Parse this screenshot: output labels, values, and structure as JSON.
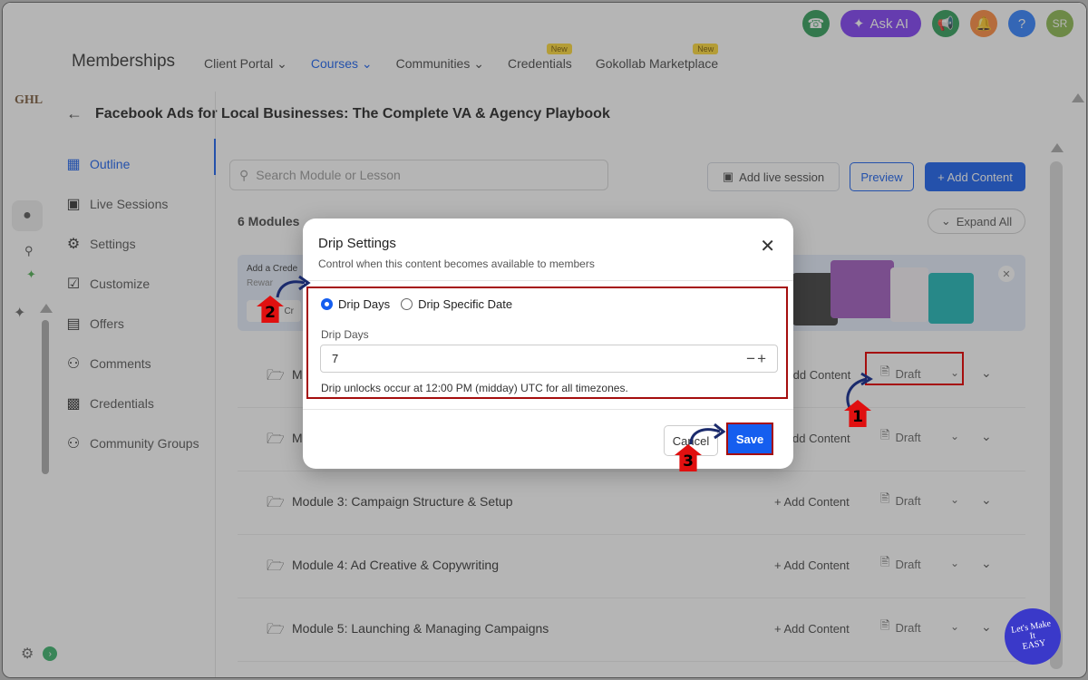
{
  "topbar": {
    "ask_ai": "Ask AI",
    "avatar_initials": "SR",
    "icons": [
      "phone-icon",
      "ask-ai-sparkle-icon",
      "megaphone-icon",
      "bell-icon",
      "help-icon",
      "avatar"
    ],
    "colors": {
      "phone": "#2e9d57",
      "askai": "#7e3cf5",
      "megaphone": "#2e9d57",
      "bell": "#ff8a3c",
      "help": "#2f80ff",
      "avatar": "#8bb94e"
    }
  },
  "header": {
    "brand": "Memberships",
    "nav": [
      {
        "label": "Client Portal",
        "chevron": true,
        "active": false
      },
      {
        "label": "Courses",
        "chevron": true,
        "active": true
      },
      {
        "label": "Communities",
        "chevron": true,
        "active": false
      },
      {
        "label": "Credentials",
        "badge": "New",
        "active": false
      },
      {
        "label": "Gokollab Marketplace",
        "badge": "New",
        "active": false
      }
    ],
    "logo": "GHL",
    "course_title": "Facebook Ads for Local Businesses: The Complete VA & Agency Playbook"
  },
  "sidebar": {
    "items": [
      {
        "label": "Outline",
        "icon": "table-icon",
        "active": true
      },
      {
        "label": "Live Sessions",
        "icon": "video-icon",
        "active": false
      },
      {
        "label": "Settings",
        "icon": "gear-icon",
        "active": false
      },
      {
        "label": "Customize",
        "icon": "clipboard-icon",
        "active": false
      },
      {
        "label": "Offers",
        "icon": "chart-icon",
        "active": false
      },
      {
        "label": "Comments",
        "icon": "users-icon",
        "active": false
      },
      {
        "label": "Credentials",
        "icon": "certificate-icon",
        "active": false
      },
      {
        "label": "Community Groups",
        "icon": "group-icon",
        "active": false
      }
    ]
  },
  "main": {
    "search_placeholder": "Search Module or Lesson",
    "add_live_session": "Add live session",
    "preview": "Preview",
    "add_content": "+ Add Content",
    "module_count": "6 Modules",
    "expand_all": "Expand All",
    "banner_title": "Add a Crede",
    "banner_sub": "Rewar",
    "banner_btn": "Cr",
    "modules": [
      {
        "title": "M",
        "add": "Add Content",
        "status": "Draft"
      },
      {
        "title": "M",
        "add": "dd Content",
        "status": "Draft"
      },
      {
        "title": "Module 3: Campaign Structure & Setup",
        "add": "+ Add Content",
        "status": "Draft"
      },
      {
        "title": "Module 4: Ad Creative & Copywriting",
        "add": "+ Add Content",
        "status": "Draft"
      },
      {
        "title": "Module 5: Launching & Managing Campaigns",
        "add": "+ Add Content",
        "status": "Draft"
      }
    ]
  },
  "modal": {
    "title": "Drip Settings",
    "subtitle": "Control when this content becomes available to members",
    "option_days": "Drip Days",
    "option_date": "Drip Specific Date",
    "selected": "Drip Days",
    "field_label": "Drip Days",
    "field_value": "7",
    "note": "Drip unlocks occur at 12:00 PM (midday) UTC for all timezones.",
    "cancel": "Cancel",
    "save": "Save"
  },
  "annotations": {
    "step1": "1",
    "step2": "2",
    "step3": "3",
    "highlight_color": "#a50e0e",
    "marker_color": "#e01010"
  },
  "watermark": {
    "line1": "Let's Make",
    "line2": "It",
    "line3": "EASY"
  }
}
